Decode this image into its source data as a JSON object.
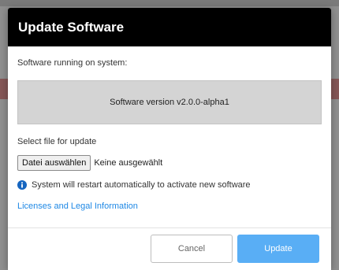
{
  "dialog": {
    "title": "Update Software",
    "running_label": "Software running on system:",
    "version_text": "Software version v2.0.0-alpha1",
    "select_label": "Select file for update",
    "file_button_label": "Datei auswählen",
    "file_status": "Keine ausgewählt",
    "info_text": "System will restart automatically to activate new software",
    "info_icon": "info-circle-icon",
    "legal_link": "Licenses and Legal Information",
    "cancel_label": "Cancel",
    "update_label": "Update"
  },
  "colors": {
    "header_bg": "#000000",
    "version_box_bg": "#d4d4d4",
    "link": "#1e88e5",
    "update_button": "#59aef5",
    "info_icon": "#1565c0"
  }
}
